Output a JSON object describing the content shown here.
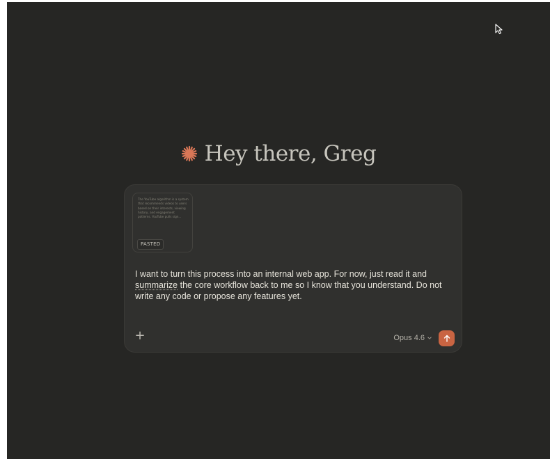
{
  "greeting": {
    "text": "Hey there, Greg",
    "icon": "claude-spark-icon",
    "icon_color": "#d97757"
  },
  "composer": {
    "attachment": {
      "preview_text": "The YouTube algorithm is a system that recommends videos to users based on their interests, viewing history, and engagement patterns. YouTube pulls sign...",
      "badge": "PASTED"
    },
    "prompt": {
      "before_underline": "I want to turn this process into an internal web app. For now, just read it and ",
      "underlined_word": "summarize",
      "after_underline": " the core workflow back to me so I know that you understand. Do not write any code or propose any features yet."
    },
    "add_button_label": "+",
    "model": {
      "selected": "Opus 4.6",
      "icon": "chevron-down-icon"
    },
    "send_button": {
      "icon": "arrow-up-icon",
      "color": "#c96442"
    }
  },
  "background_color": "#262624"
}
